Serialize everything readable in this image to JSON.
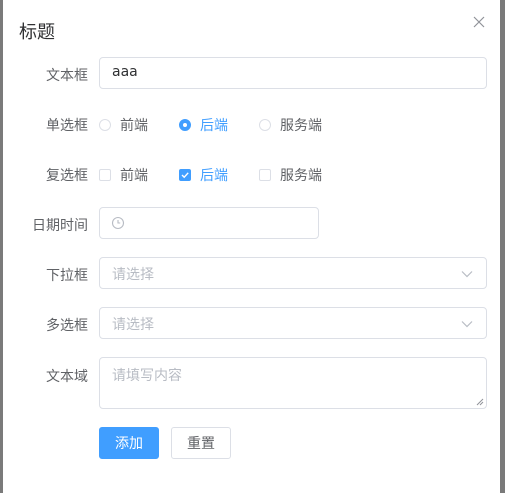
{
  "dialog": {
    "title": "标题"
  },
  "form": {
    "text_field": {
      "label": "文本框",
      "value": "aaa"
    },
    "radio": {
      "label": "单选框",
      "options": [
        "前端",
        "后端",
        "服务端"
      ],
      "selected": "后端"
    },
    "checkbox": {
      "label": "复选框",
      "options": [
        "前端",
        "后端",
        "服务端"
      ],
      "checked": [
        "后端"
      ]
    },
    "datetime": {
      "label": "日期时间",
      "value": ""
    },
    "select": {
      "label": "下拉框",
      "placeholder": "请选择"
    },
    "multiselect": {
      "label": "多选框",
      "placeholder": "请选择"
    },
    "textarea": {
      "label": "文本域",
      "placeholder": "请填写内容"
    }
  },
  "buttons": {
    "add": "添加",
    "reset": "重置"
  },
  "colors": {
    "primary": "#409eff",
    "text": "#606266",
    "placeholder": "#b8bcc4",
    "border": "#dcdfe6"
  }
}
